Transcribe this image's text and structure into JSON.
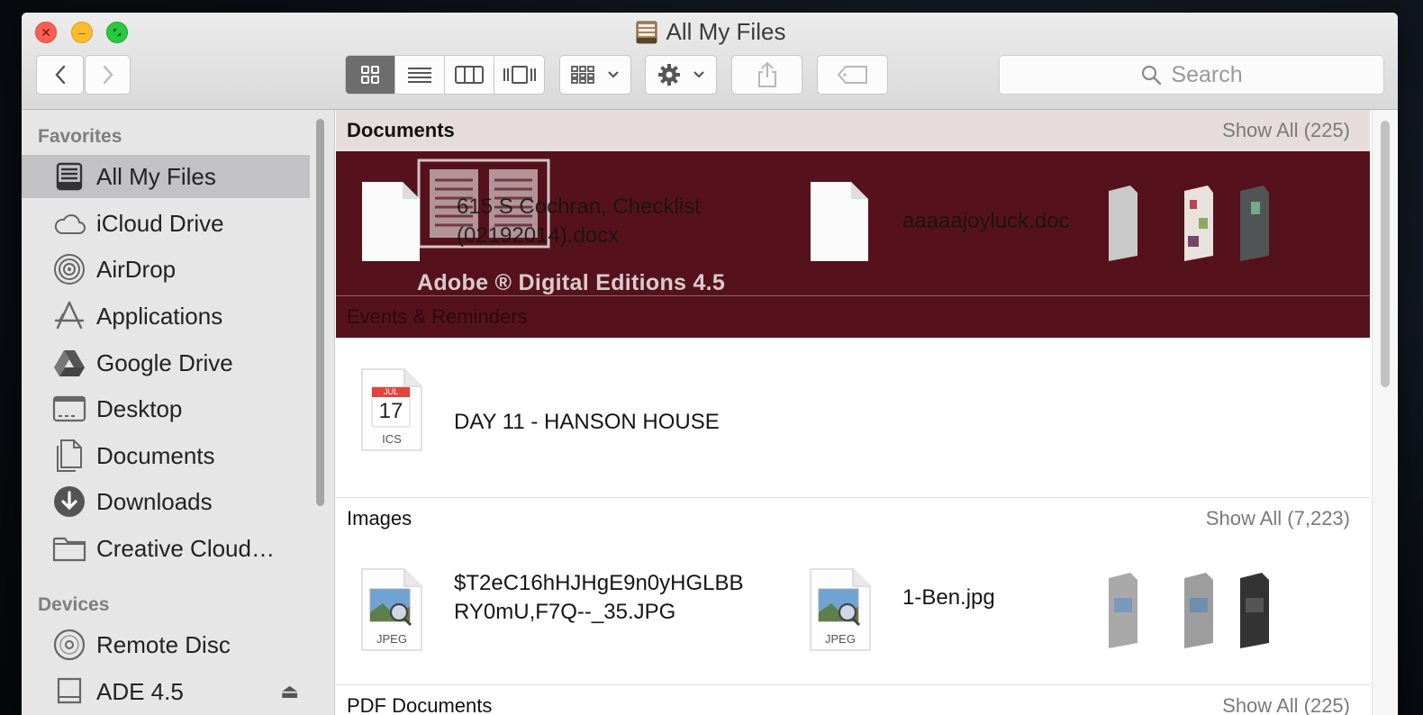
{
  "window": {
    "title": "All My Files"
  },
  "toolbar": {
    "back_label": "back",
    "forward_label": "forward",
    "search_placeholder": "Search"
  },
  "sidebar": {
    "favorites_heading": "Favorites",
    "devices_heading": "Devices",
    "favorites": [
      {
        "label": "All My Files",
        "icon": "all-my-files-icon",
        "selected": true
      },
      {
        "label": "iCloud Drive",
        "icon": "cloud-icon"
      },
      {
        "label": "AirDrop",
        "icon": "airdrop-icon"
      },
      {
        "label": "Applications",
        "icon": "applications-icon"
      },
      {
        "label": "Google Drive",
        "icon": "google-drive-icon"
      },
      {
        "label": "Desktop",
        "icon": "desktop-icon"
      },
      {
        "label": "Documents",
        "icon": "documents-icon"
      },
      {
        "label": "Downloads",
        "icon": "downloads-icon"
      },
      {
        "label": "Creative Cloud…",
        "icon": "folder-icon"
      }
    ],
    "devices": [
      {
        "label": "Remote Disc",
        "icon": "disc-icon"
      },
      {
        "label": "ADE 4.5",
        "icon": "drive-icon",
        "eject": "⏏"
      }
    ]
  },
  "sections": {
    "documents": {
      "title": "Documents",
      "show_all": "Show All (225)",
      "file1_line1": "615 S Cochran, Checklist",
      "file1_line2": "(02192014).docx",
      "file2": "aaaaajoyluck.doc",
      "overlay_text": "Adobe ® Digital Editions 4.5"
    },
    "events": {
      "title": "Events & Reminders",
      "file1": "DAY 11 - HANSON HOUSE",
      "calendar_month": "JUL",
      "calendar_day": "17",
      "calendar_ext": "ICS"
    },
    "images": {
      "title": "Images",
      "show_all": "Show All (7,223)",
      "file1_line1": "$T2eC16hHJHgE9n0yHGLBB",
      "file1_line2": "RY0mU,F7Q--_35.JPG",
      "file2": "1-Ben.jpg",
      "ext": "JPEG"
    },
    "pdf": {
      "title": "PDF Documents",
      "show_all": "Show All (225)"
    }
  },
  "colors": {
    "selection_band": "#56121c",
    "sidebar_bg": "#e6e6e7",
    "sidebar_selected": "#c2c2c4"
  }
}
